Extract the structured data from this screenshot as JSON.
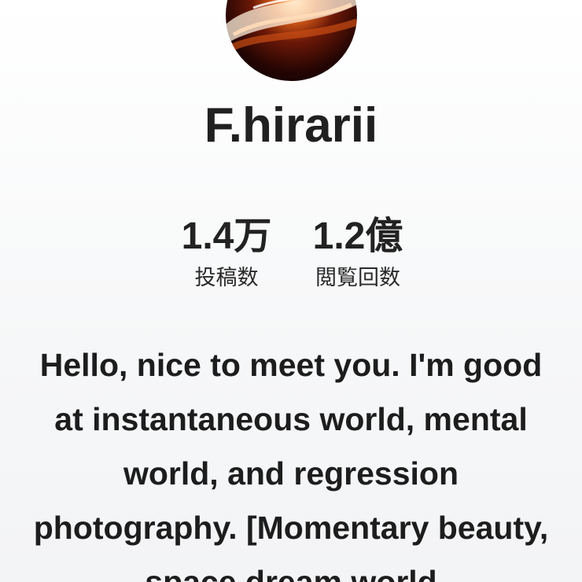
{
  "profile": {
    "username": "F.hirarii",
    "avatar_icon": "profile-photo"
  },
  "stats": {
    "posts": {
      "value": "1.4万",
      "label": "投稿数"
    },
    "views": {
      "value": "1.2億",
      "label": "閲覧回数"
    }
  },
  "bio": {
    "text": "Hello, nice to meet you. I'm good at instantaneous world, mental world, and regression photography. [Momentary beauty, space dream world"
  }
}
